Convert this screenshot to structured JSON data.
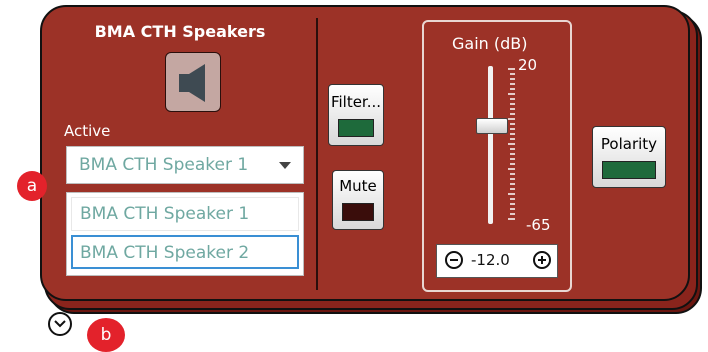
{
  "panel": {
    "title": "BMA CTH Speakers",
    "active_label": "Active",
    "selected_speaker": "BMA CTH Speaker 1",
    "speaker_list": [
      "BMA CTH Speaker 1",
      "BMA CTH Speaker 2"
    ],
    "speaker_icon": "speaker-icon"
  },
  "controls": {
    "filter_label": "Filter...",
    "filter_led_color": "#1e6a3b",
    "mute_label": "Mute",
    "mute_led_color": "#3a0d0b",
    "polarity_label": "Polarity",
    "polarity_led_color": "#1e6a3b"
  },
  "gain": {
    "label": "Gain  (dB)",
    "max": "20",
    "min": "-65",
    "value": "-12.0",
    "value_num": -12.0
  },
  "annotations": {
    "a": "a",
    "b": "b"
  },
  "colors": {
    "panel_bg": "#9c3227",
    "accent_select": "#3a8fd4",
    "list_text": "#6fa8a1",
    "callout": "#e3222b"
  }
}
